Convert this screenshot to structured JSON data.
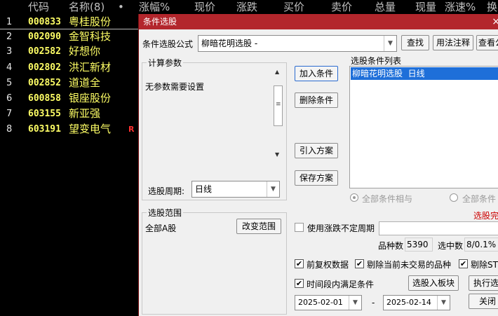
{
  "stock_list": {
    "headers": [
      "代码",
      "名称(8)",
      "•",
      "涨幅%",
      "现价",
      "涨跌",
      "买价",
      "卖价",
      "总量",
      "现量",
      "涨速%",
      "换"
    ],
    "rows": [
      {
        "idx": "1",
        "code": "000833",
        "name": "粤桂股份",
        "flag": ""
      },
      {
        "idx": "2",
        "code": "002090",
        "name": "金智科技",
        "flag": ""
      },
      {
        "idx": "3",
        "code": "002582",
        "name": "好想你",
        "flag": ""
      },
      {
        "idx": "4",
        "code": "002802",
        "name": "洪汇新材",
        "flag": ""
      },
      {
        "idx": "5",
        "code": "002852",
        "name": "道道全",
        "flag": ""
      },
      {
        "idx": "6",
        "code": "600858",
        "name": "银座股份",
        "flag": ""
      },
      {
        "idx": "7",
        "code": "603155",
        "name": "新亚强",
        "flag": ""
      },
      {
        "idx": "8",
        "code": "603191",
        "name": "望变电气",
        "flag": "R"
      }
    ]
  },
  "dialog": {
    "title": "条件选股",
    "close_glyph": "×",
    "formula_label": "条件选股公式",
    "formula_value": "柳暗花明选股 -",
    "find_button": "查找",
    "usage_button": "用法注释",
    "view_button": "查看公",
    "params_group": "计算参数",
    "params_text": "无参数需要设置",
    "period_label": "选股周期:",
    "period_value": "日线",
    "add_condition": "加入条件",
    "delete_condition": "删除条件",
    "import_plan": "引入方案",
    "save_plan": "保存方案",
    "condition_list_label": "选股条件列表",
    "condition_items": [
      "柳暗花明选股  日线"
    ],
    "radio_and": "全部条件相与",
    "radio_or": "全部条件",
    "status_text": "选股完",
    "status_color": "#cc0000",
    "scope_group": "选股范围",
    "scope_value": "全部A股",
    "change_scope": "改变范围",
    "use_period_label": "使用涨跌不定周期",
    "count_label": "品种数",
    "count_value": "5390",
    "selected_label": "选中数",
    "selected_value": "8/0.1%",
    "chk_prior_adj": "前复权数据",
    "chk_exclude_notrade": "剔除当前未交易的品种",
    "chk_exclude_st": "剔除ST",
    "chk_time_range": "时间段内满足条件",
    "to_block_button": "选股入板块",
    "execute_button": "执行选",
    "close_button": "关闭",
    "date_from": "2025-02-01",
    "date_sep": "-",
    "date_to": "2025-02-14",
    "accent_color": "#b3262c"
  }
}
